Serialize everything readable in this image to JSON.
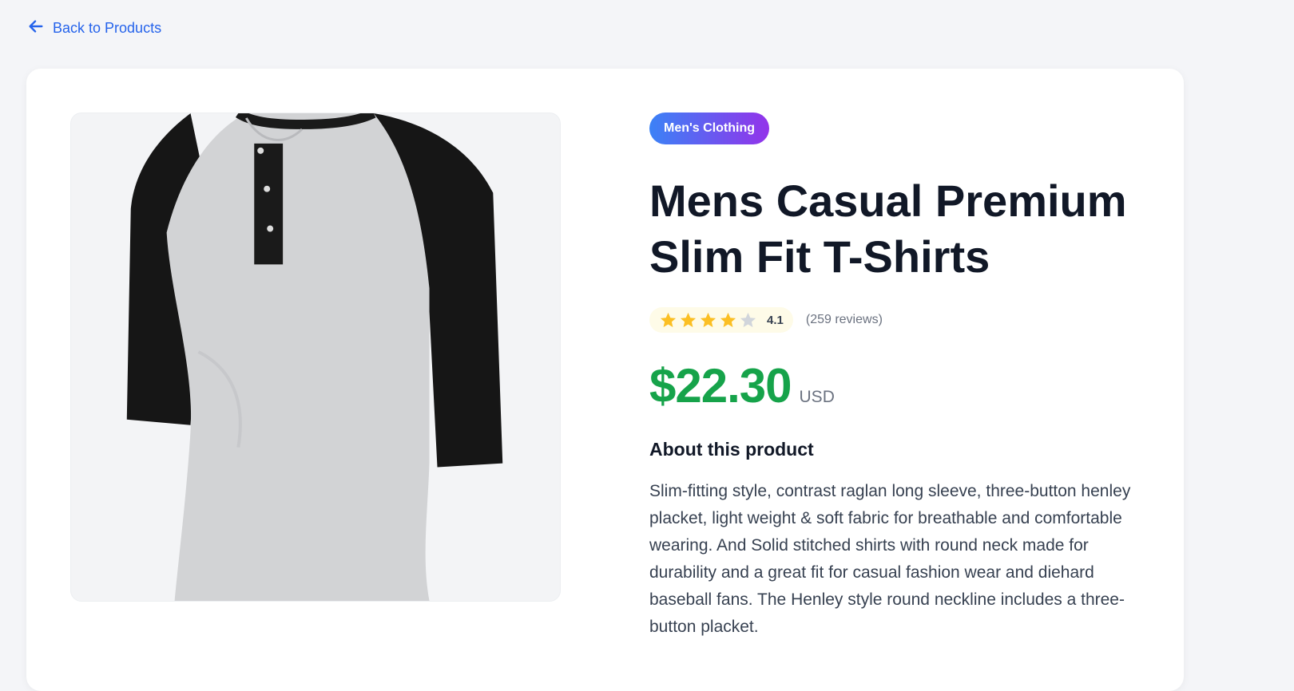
{
  "nav": {
    "back_label": "Back to Products"
  },
  "product": {
    "category": "Men's Clothing",
    "title": "Mens Casual Premium Slim Fit T-Shirts",
    "rating": {
      "value": "4.1",
      "stars_filled": 4,
      "stars_total": 5,
      "reviews": "(259 reviews)"
    },
    "price": "$22.30",
    "currency": "USD",
    "about_heading": "About this product",
    "description": "Slim-fitting style, contrast raglan long sleeve, three-button henley placket, light weight & soft fabric for breathable and comfortable wearing. And Solid stitched shirts with round neck made for durability and a great fit for casual fashion wear and diehard baseball fans. The Henley style round neckline includes a three-button placket.",
    "image_alt": "Raglan henley t-shirt with black sleeves and grey body"
  },
  "colors": {
    "accent": "#2563eb",
    "price": "#16a34a",
    "badge_gradient_start": "#3b82f6",
    "badge_gradient_end": "#9333ea",
    "star_filled": "#fbbf24",
    "star_empty": "#d1d5db"
  }
}
